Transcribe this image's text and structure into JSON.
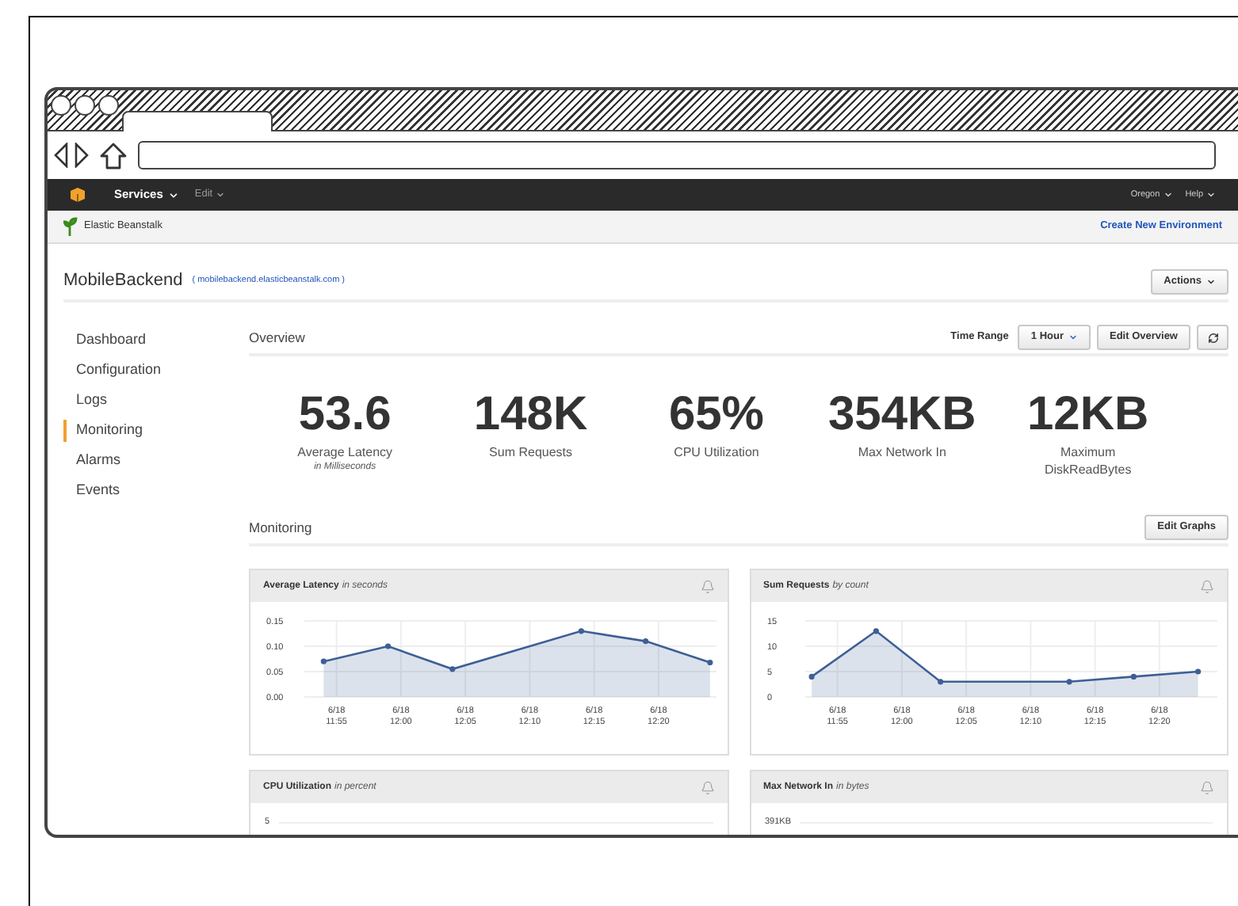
{
  "nav": {
    "services": "Services",
    "edit": "Edit",
    "region": "Oregon",
    "help": "Help"
  },
  "breadcrumb": {
    "service": "Elastic Beanstalk",
    "create_link": "Create New Environment"
  },
  "environment": {
    "name": "MobileBackend",
    "url": "( mobilebackend.elasticbeanstalk.com )",
    "actions": "Actions"
  },
  "sidebar": {
    "items": [
      {
        "label": "Dashboard",
        "selected": false
      },
      {
        "label": "Configuration",
        "selected": false
      },
      {
        "label": "Logs",
        "selected": false
      },
      {
        "label": "Monitoring",
        "selected": true
      },
      {
        "label": "Alarms",
        "selected": false
      },
      {
        "label": "Events",
        "selected": false
      }
    ]
  },
  "overview": {
    "title": "Overview",
    "time_range_label": "Time Range",
    "time_range": "1 Hour",
    "edit_button": "Edit Overview",
    "stats": [
      {
        "value": "53.6",
        "label": "Average Latency",
        "sublabel": "in Milliseconds"
      },
      {
        "value": "148K",
        "label": "Sum Requests"
      },
      {
        "value": "65%",
        "label": "CPU Utilization"
      },
      {
        "value": "354KB",
        "label": "Max Network In"
      },
      {
        "value": "12KB",
        "label": "Maximum DiskReadBytes"
      }
    ]
  },
  "monitoring": {
    "title": "Monitoring",
    "edit_button": "Edit Graphs",
    "graphs": [
      {
        "title": "Average Latency",
        "unit": "in seconds",
        "chart_data": {
          "type": "area",
          "grid": true,
          "categories": [
            null,
            null,
            "6/18 11:55",
            null,
            null,
            null,
            null,
            "6/18 12:00",
            null,
            null,
            null,
            null,
            "6/18 12:05",
            null,
            null,
            null,
            null,
            "6/18 12:10",
            null,
            null,
            null,
            null,
            "6/18 12:15",
            null,
            null,
            null,
            null,
            "6/18 12:20",
            null,
            null,
            null,
            null
          ],
          "series": [
            {
              "color": "#3d5f96",
              "values": [
                null,
                0.07,
                null,
                null,
                null,
                null,
                0.1,
                null,
                null,
                null,
                null,
                0.055,
                null,
                null,
                null,
                null,
                null,
                null,
                null,
                null,
                null,
                0.13,
                null,
                null,
                null,
                null,
                0.11,
                null,
                null,
                null,
                null,
                0.068
              ]
            }
          ],
          "ylim": [
            0,
            0.15
          ],
          "yticks": [
            {
              "value": 0,
              "label": "0.00"
            },
            {
              "value": 0.05,
              "label": "0.05"
            },
            {
              "value": 0.1,
              "label": "0.10"
            },
            {
              "value": 0.15,
              "label": "0.15"
            }
          ]
        }
      },
      {
        "title": "Sum Requests",
        "unit": "by count",
        "chart_data": {
          "type": "area",
          "grid": true,
          "categories": [
            null,
            null,
            "6/18 11:55",
            null,
            null,
            null,
            null,
            "6/18 12:00",
            null,
            null,
            null,
            null,
            "6/18 12:05",
            null,
            null,
            null,
            null,
            "6/18 12:10",
            null,
            null,
            null,
            null,
            "6/18 12:15",
            null,
            null,
            null,
            null,
            "6/18 12:20",
            null,
            null,
            null,
            null
          ],
          "series": [
            {
              "color": "#3d5f96",
              "values": [
                4,
                null,
                null,
                null,
                null,
                13,
                null,
                null,
                null,
                null,
                3,
                null,
                null,
                null,
                null,
                null,
                null,
                null,
                null,
                null,
                3,
                null,
                null,
                null,
                null,
                4,
                null,
                null,
                null,
                null,
                5,
                null
              ]
            }
          ],
          "ylim": [
            0,
            15
          ],
          "yticks": [
            {
              "value": 0,
              "label": "0"
            },
            {
              "value": 5,
              "label": "5"
            },
            {
              "value": 10,
              "label": "10"
            },
            {
              "value": 15,
              "label": "15"
            }
          ]
        }
      },
      {
        "title": "CPU Utilization",
        "unit": "in percent",
        "top_tick": "5"
      },
      {
        "title": "Max Network In",
        "unit": "in bytes",
        "top_tick": "391KB"
      }
    ]
  }
}
